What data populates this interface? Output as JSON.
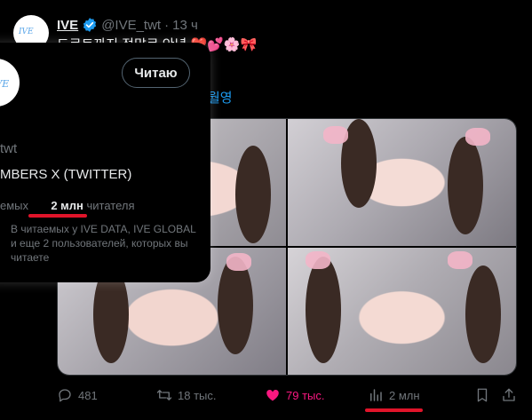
{
  "tweet": {
    "author_name": "IVE",
    "handle": "@IVE_twt",
    "separator": "·",
    "time": "13 ч",
    "text": "드르트까지 정말로 안녕",
    "emojis": [
      "❤️",
      "💕",
      "🌸",
      "🎀"
    ],
    "text_tail": "월영",
    "avatar_logo_text": "IVE"
  },
  "actions": {
    "replies": "481",
    "retweets": "18 тыс.",
    "likes": "79 тыс.",
    "views": "2 млн"
  },
  "hovercard": {
    "follow_label": "Читаю",
    "handle_partial": "twt",
    "bio": "MBERS X (TWITTER)",
    "following_label": "емых",
    "followers_count": "2 млн",
    "followers_label": "читателя",
    "followed_by": "В читаемых у IVE DATA, IVE GLOBAL и еще 2 пользователей, которых вы читаете"
  },
  "colors": {
    "background": "#000000",
    "accent": "#1d9bf0",
    "like": "#f91880",
    "annotation": "#e0142a"
  },
  "icons": [
    "verified-badge-icon",
    "reply-icon",
    "retweet-icon",
    "heart-icon",
    "views-icon",
    "bookmark-icon",
    "share-icon"
  ]
}
